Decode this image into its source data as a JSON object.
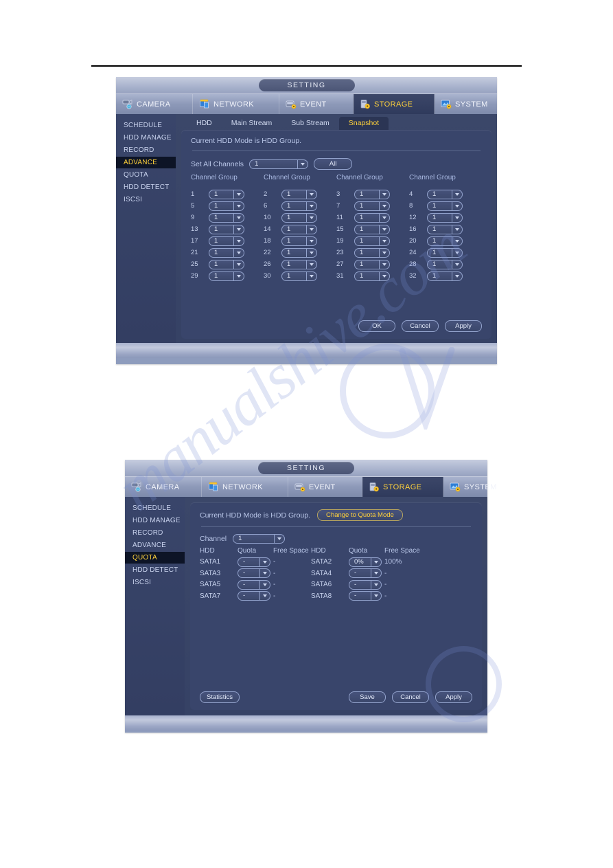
{
  "theme": {
    "accent_gold": "#ffd23b",
    "panel_bg": "#39456b",
    "sidebar_bg": "#39456a",
    "active_tab_bg": "#2f3a5c",
    "text_blue": "#b9c6e8"
  },
  "window_title": "SETTING",
  "main_tabs": [
    {
      "label": "CAMERA",
      "icon": "camera-icon",
      "active": false
    },
    {
      "label": "NETWORK",
      "icon": "network-icon",
      "active": false
    },
    {
      "label": "EVENT",
      "icon": "event-icon",
      "active": false
    },
    {
      "label": "STORAGE",
      "icon": "storage-icon",
      "active": true
    },
    {
      "label": "SYSTEM",
      "icon": "system-icon",
      "active": false
    }
  ],
  "sidebar_items": [
    "SCHEDULE",
    "HDD MANAGE",
    "RECORD",
    "ADVANCE",
    "QUOTA",
    "HDD DETECT",
    "ISCSI"
  ],
  "panel_advance": {
    "active_sidebar": "ADVANCE",
    "sub_tabs": [
      {
        "label": "HDD",
        "active": false
      },
      {
        "label": "Main Stream",
        "active": false
      },
      {
        "label": "Sub Stream",
        "active": false
      },
      {
        "label": "Snapshot",
        "active": true
      }
    ],
    "hdd_mode_text": "Current HDD Mode is HDD Group.",
    "set_all_label": "Set All Channels",
    "set_all_value": "1",
    "all_button": "All",
    "column_header": "Channel Group",
    "columns": 4,
    "channels": [
      {
        "num": "1",
        "group": "1"
      },
      {
        "num": "2",
        "group": "1"
      },
      {
        "num": "3",
        "group": "1"
      },
      {
        "num": "4",
        "group": "1"
      },
      {
        "num": "5",
        "group": "1"
      },
      {
        "num": "6",
        "group": "1"
      },
      {
        "num": "7",
        "group": "1"
      },
      {
        "num": "8",
        "group": "1"
      },
      {
        "num": "9",
        "group": "1"
      },
      {
        "num": "10",
        "group": "1"
      },
      {
        "num": "11",
        "group": "1"
      },
      {
        "num": "12",
        "group": "1"
      },
      {
        "num": "13",
        "group": "1"
      },
      {
        "num": "14",
        "group": "1"
      },
      {
        "num": "15",
        "group": "1"
      },
      {
        "num": "16",
        "group": "1"
      },
      {
        "num": "17",
        "group": "1"
      },
      {
        "num": "18",
        "group": "1"
      },
      {
        "num": "19",
        "group": "1"
      },
      {
        "num": "20",
        "group": "1"
      },
      {
        "num": "21",
        "group": "1"
      },
      {
        "num": "22",
        "group": "1"
      },
      {
        "num": "23",
        "group": "1"
      },
      {
        "num": "24",
        "group": "1"
      },
      {
        "num": "25",
        "group": "1"
      },
      {
        "num": "26",
        "group": "1"
      },
      {
        "num": "27",
        "group": "1"
      },
      {
        "num": "28",
        "group": "1"
      },
      {
        "num": "29",
        "group": "1"
      },
      {
        "num": "30",
        "group": "1"
      },
      {
        "num": "31",
        "group": "1"
      },
      {
        "num": "32",
        "group": "1"
      }
    ],
    "buttons": {
      "ok": "OK",
      "cancel": "Cancel",
      "apply": "Apply"
    }
  },
  "panel_quota": {
    "active_sidebar": "QUOTA",
    "hdd_mode_text": "Current HDD Mode is HDD Group.",
    "change_mode_button": "Change to Quota Mode",
    "channel_label": "Channel",
    "channel_value": "1",
    "table_headers": [
      "HDD",
      "Quota",
      "Free Space",
      "HDD",
      "Quota",
      "Free Space"
    ],
    "rows": [
      {
        "hdd_l": "SATA1",
        "quota_l": "-",
        "free_l": "-",
        "hdd_r": "SATA2",
        "quota_r": "0%",
        "free_r": "100%"
      },
      {
        "hdd_l": "SATA3",
        "quota_l": "-",
        "free_l": "-",
        "hdd_r": "SATA4",
        "quota_r": "-",
        "free_r": "-"
      },
      {
        "hdd_l": "SATA5",
        "quota_l": "-",
        "free_l": "-",
        "hdd_r": "SATA6",
        "quota_r": "-",
        "free_r": "-"
      },
      {
        "hdd_l": "SATA7",
        "quota_l": "-",
        "free_l": "-",
        "hdd_r": "SATA8",
        "quota_r": "-",
        "free_r": "-"
      }
    ],
    "buttons": {
      "statistics": "Statistics",
      "save": "Save",
      "cancel": "Cancel",
      "apply": "Apply"
    }
  },
  "watermark": {
    "text": "manualshive.com"
  }
}
